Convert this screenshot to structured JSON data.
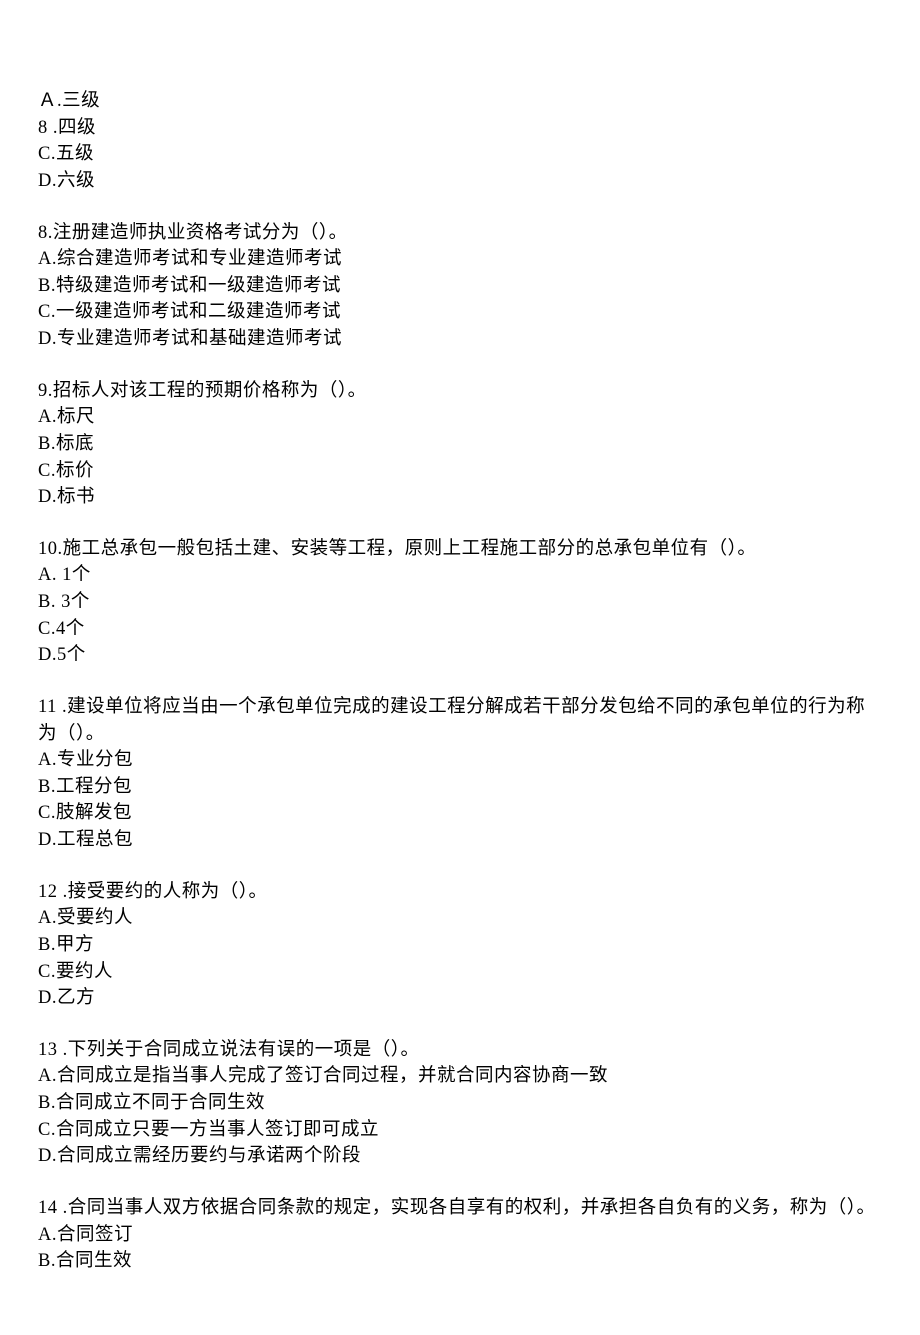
{
  "q7_options": {
    "a": "Ａ.三级",
    "b": "8 .四级",
    "c": "C.五级",
    "d": "D.六级"
  },
  "q8": {
    "stem": "8.注册建造师执业资格考试分为（）。",
    "a": "A.综合建造师考试和专业建造师考试",
    "b": "B.特级建造师考试和一级建造师考试",
    "c": "C.一级建造师考试和二级建造师考试",
    "d": "D.专业建造师考试和基础建造师考试"
  },
  "q9": {
    "stem": "9.招标人对该工程的预期价格称为（）。",
    "a": "A.标尺",
    "b": "B.标底",
    "c": "C.标价",
    "d": "D.标书"
  },
  "q10": {
    "stem": "10.施工总承包一般包括土建、安装等工程，原则上工程施工部分的总承包单位有（）。",
    "a": "A. 1个",
    "b": "B. 3个",
    "c": "C.4个",
    "d": "D.5个"
  },
  "q11": {
    "stem": "11 .建设单位将应当由一个承包单位完成的建设工程分解成若干部分发包给不同的承包单位的行为称为（）。",
    "a": "A.专业分包",
    "b": "B.工程分包",
    "c": "C.肢解发包",
    "d": "D.工程总包"
  },
  "q12": {
    "stem": "12 .接受要约的人称为（）。",
    "a": "A.受要约人",
    "b": "B.甲方",
    "c": "C.要约人",
    "d": "D.乙方"
  },
  "q13": {
    "stem": "13 .下列关于合同成立说法有误的一项是（）。",
    "a": "A.合同成立是指当事人完成了签订合同过程，并就合同内容协商一致",
    "b": "B.合同成立不同于合同生效",
    "c": "C.合同成立只要一方当事人签订即可成立",
    "d": "D.合同成立需经历要约与承诺两个阶段"
  },
  "q14": {
    "stem": "14 .合同当事人双方依据合同条款的规定，实现各自享有的权利，并承担各自负有的义务，称为（）。",
    "a": "A.合同签订",
    "b": "B.合同生效"
  }
}
